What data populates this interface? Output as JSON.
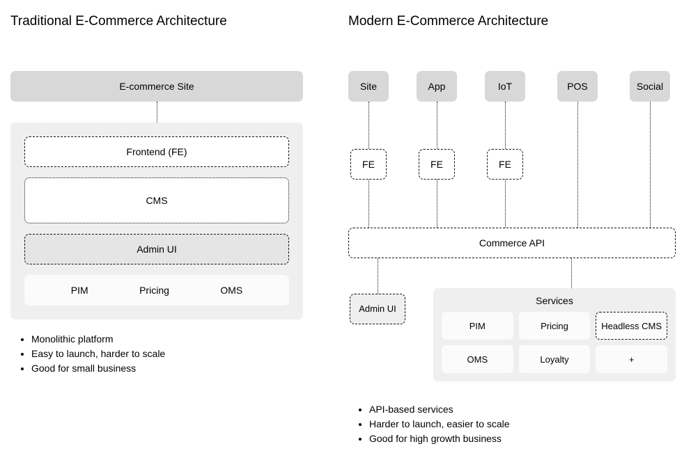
{
  "left": {
    "title": "Traditional E-Commerce Architecture",
    "site": "E-commerce Site",
    "frontend": "Frontend (FE)",
    "cms": "CMS",
    "admin": "Admin UI",
    "services": [
      "PIM",
      "Pricing",
      "OMS"
    ],
    "bullets": [
      "Monolithic platform",
      "Easy to launch, harder to scale",
      "Good for small business"
    ]
  },
  "right": {
    "title": "Modern E-Commerce  Architecture",
    "channels": [
      "Site",
      "App",
      "IoT",
      "POS",
      "Social"
    ],
    "fe": "FE",
    "api": "Commerce API",
    "admin": "Admin UI",
    "servicesTitle": "Services",
    "services": [
      "PIM",
      "Pricing",
      "Headless CMS",
      "OMS",
      "Loyalty",
      "+"
    ],
    "bullets": [
      "API-based services",
      "Harder to launch, easier to scale",
      "Good for high growth business"
    ]
  }
}
